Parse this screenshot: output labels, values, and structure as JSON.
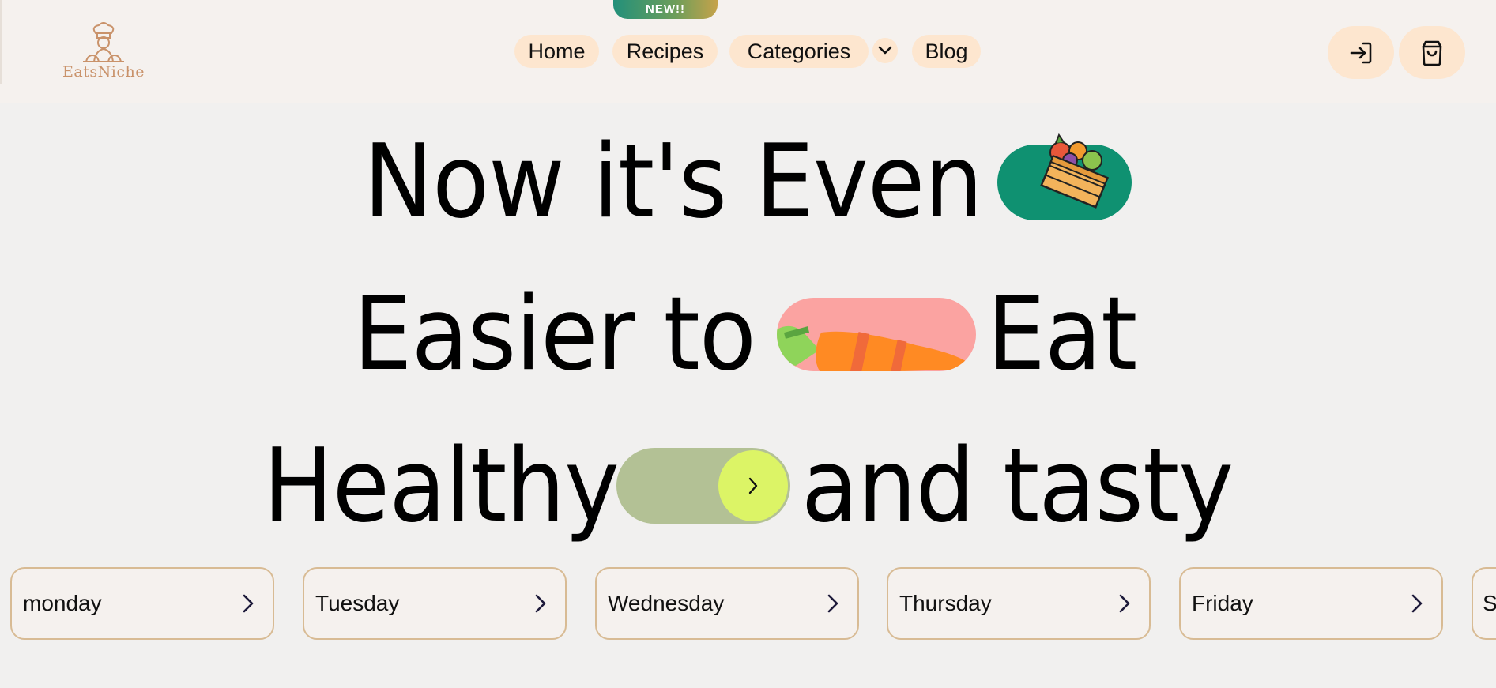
{
  "brand": {
    "name": "EatsNiche"
  },
  "badge": {
    "label": "NEW!!"
  },
  "nav": {
    "items": [
      {
        "label": "Home"
      },
      {
        "label": "Recipes"
      },
      {
        "label": "Categories"
      },
      {
        "label": "Blog"
      }
    ]
  },
  "actions": {
    "login_icon": "login-arrow-icon",
    "cart_icon": "shopping-bag-icon"
  },
  "hero": {
    "line1": {
      "text_a": "Now it's Even"
    },
    "line2": {
      "text_a": "Easier to",
      "text_b": "Eat"
    },
    "line3": {
      "text_a": "Healthy",
      "text_b": "and tasty"
    },
    "pill_icons": [
      "vegetable-crate-icon",
      "carrot-icon",
      "chevron-right-icon"
    ]
  },
  "days": [
    {
      "label": "monday"
    },
    {
      "label": "Tuesday"
    },
    {
      "label": "Wednesday"
    },
    {
      "label": "Thursday"
    },
    {
      "label": "Friday"
    },
    {
      "label": "S"
    }
  ],
  "colors": {
    "nav_pill": "#fde6cf",
    "green_pill": "#0f9171",
    "pink_pill": "#fba3a1",
    "toggle_track": "#b3c195",
    "toggle_knob": "#dcf466",
    "card_border": "#d8bb94",
    "brand": "#c9926a"
  }
}
